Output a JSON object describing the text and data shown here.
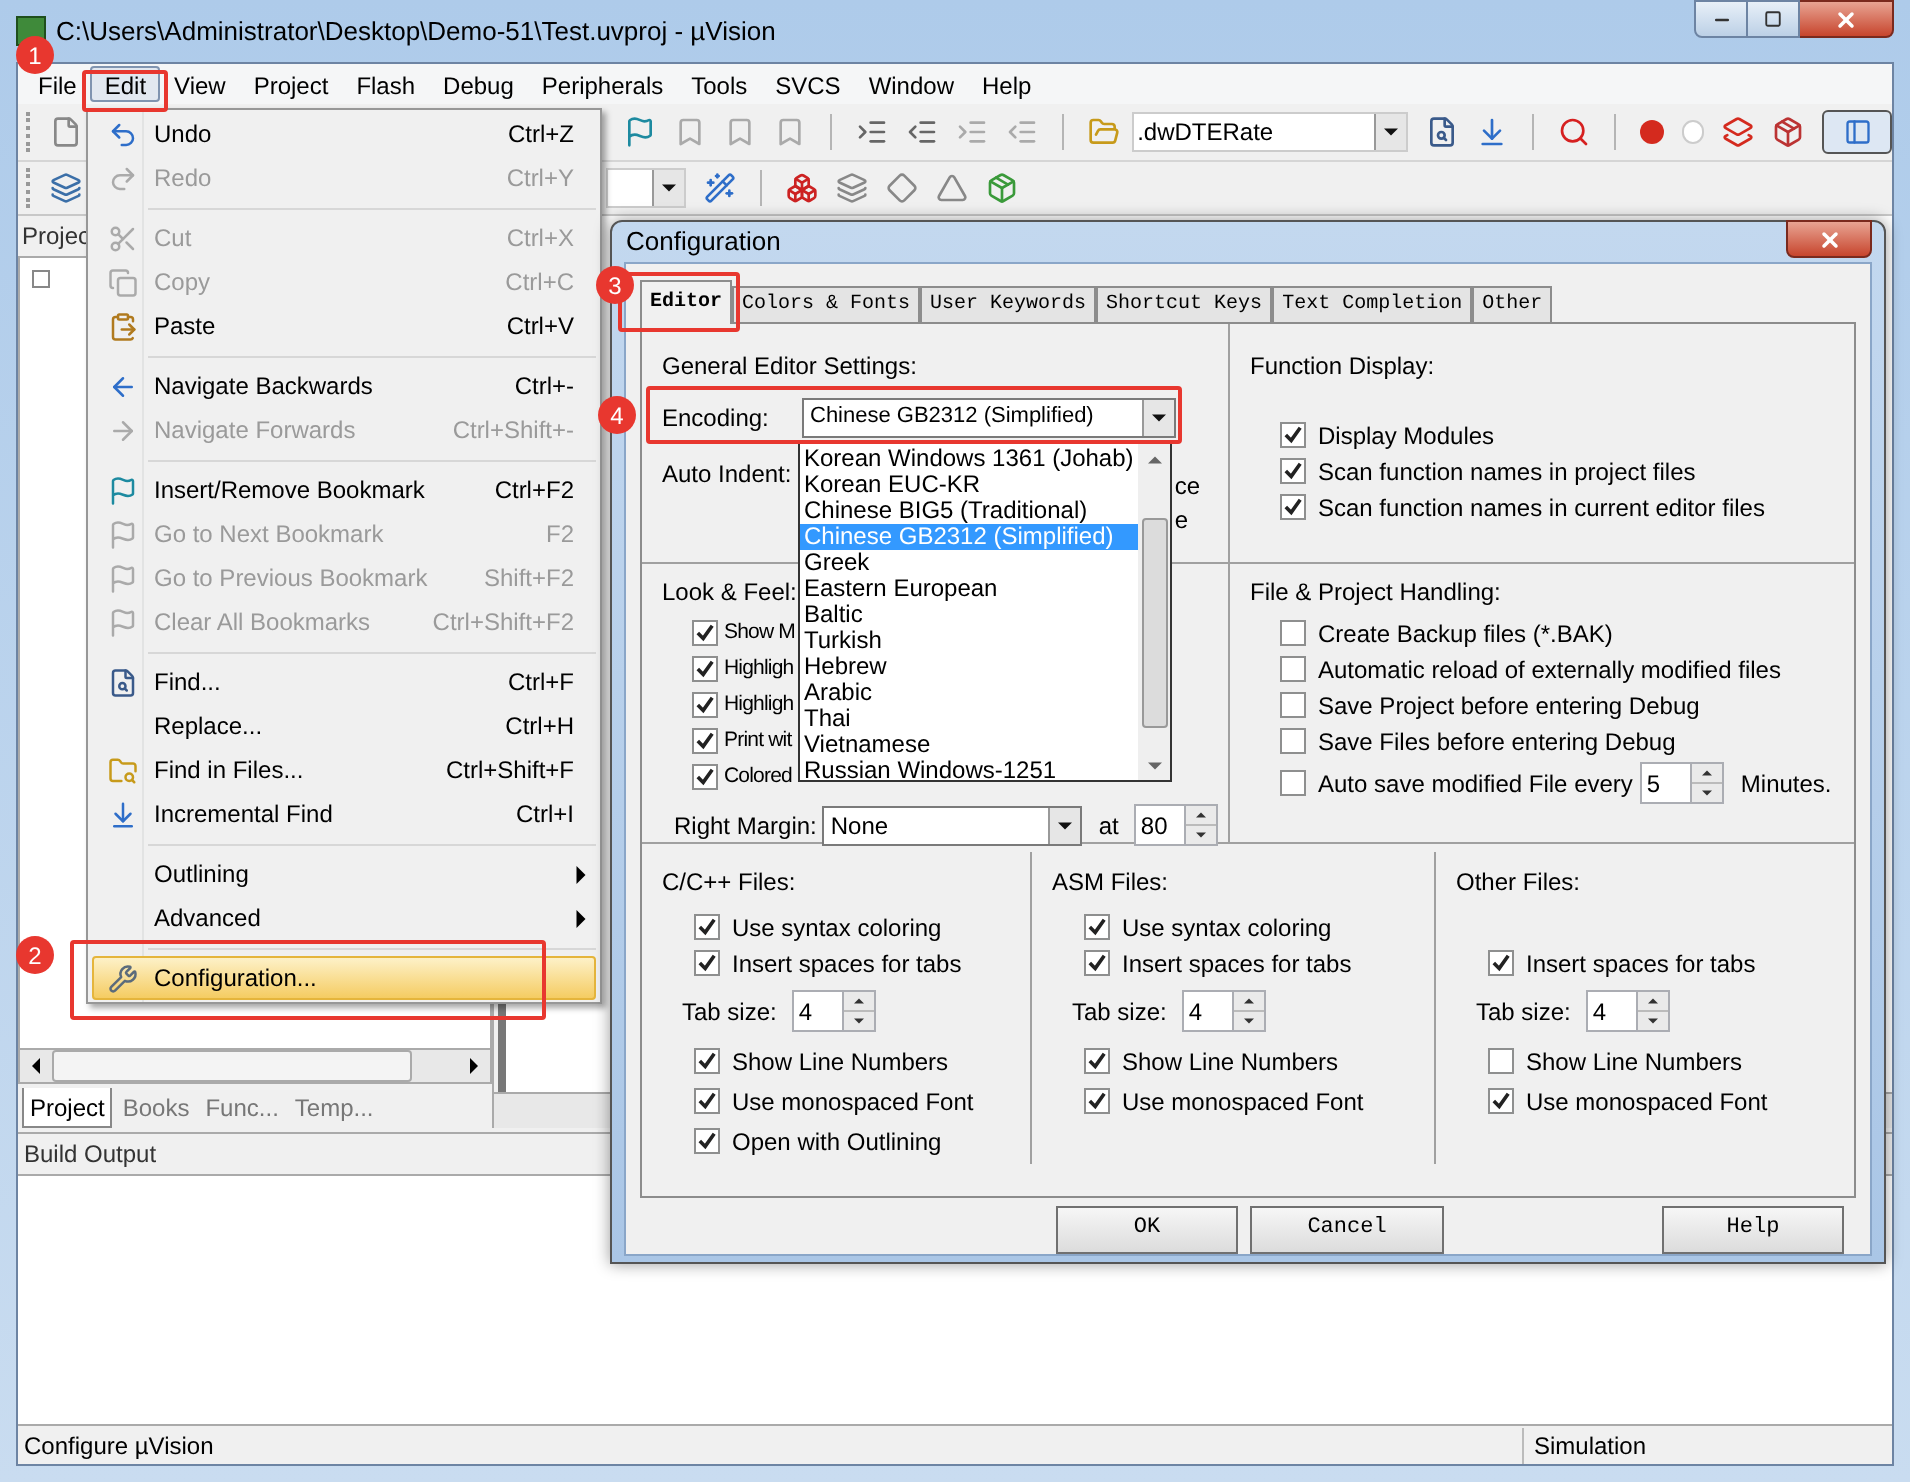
{
  "window": {
    "title": "C:\\Users\\Administrator\\Desktop\\Demo-51\\Test.uvproj - µVision"
  },
  "menu_bar": [
    {
      "label": "File",
      "selected": false
    },
    {
      "label": "Edit",
      "selected": true
    },
    {
      "label": "View",
      "selected": false
    },
    {
      "label": "Project",
      "selected": false
    },
    {
      "label": "Flash",
      "selected": false
    },
    {
      "label": "Debug",
      "selected": false
    },
    {
      "label": "Peripherals",
      "selected": false
    },
    {
      "label": "Tools",
      "selected": false
    },
    {
      "label": "SVCS",
      "selected": false
    },
    {
      "label": "Window",
      "selected": false
    },
    {
      "label": "Help",
      "selected": false
    }
  ],
  "toolbar": {
    "find_combo": ".dwDTERate"
  },
  "project_panel": {
    "title": "Projec",
    "tabs": [
      {
        "label": "Project",
        "selected": true
      },
      {
        "label": "Books",
        "selected": false
      },
      {
        "label": "Func...",
        "selected": false
      },
      {
        "label": "Temp...",
        "selected": false
      }
    ]
  },
  "build_output": {
    "title": "Build Output"
  },
  "status_bar": [
    "Configure µVision",
    "Simulation"
  ],
  "edit_menu": [
    {
      "kind": "item",
      "label": "Undo",
      "shortcut": "Ctrl+Z",
      "disabled": false,
      "selected": false
    },
    {
      "kind": "item",
      "label": "Redo",
      "shortcut": "Ctrl+Y",
      "disabled": true,
      "selected": false
    },
    {
      "kind": "separator"
    },
    {
      "kind": "item",
      "label": "Cut",
      "shortcut": "Ctrl+X",
      "disabled": true,
      "selected": false
    },
    {
      "kind": "item",
      "label": "Copy",
      "shortcut": "Ctrl+C",
      "disabled": true,
      "selected": false
    },
    {
      "kind": "item",
      "label": "Paste",
      "shortcut": "Ctrl+V",
      "disabled": false,
      "selected": false
    },
    {
      "kind": "separator"
    },
    {
      "kind": "item",
      "label": "Navigate Backwards",
      "shortcut": "Ctrl+-",
      "disabled": false,
      "selected": false
    },
    {
      "kind": "item",
      "label": "Navigate Forwards",
      "shortcut": "Ctrl+Shift+-",
      "disabled": true,
      "selected": false
    },
    {
      "kind": "separator"
    },
    {
      "kind": "item",
      "label": "Insert/Remove Bookmark",
      "shortcut": "Ctrl+F2",
      "disabled": false,
      "selected": false
    },
    {
      "kind": "item",
      "label": "Go to Next Bookmark",
      "shortcut": "F2",
      "disabled": true,
      "selected": false
    },
    {
      "kind": "item",
      "label": "Go to Previous Bookmark",
      "shortcut": "Shift+F2",
      "disabled": true,
      "selected": false
    },
    {
      "kind": "item",
      "label": "Clear All Bookmarks",
      "shortcut": "Ctrl+Shift+F2",
      "disabled": true,
      "selected": false
    },
    {
      "kind": "separator"
    },
    {
      "kind": "item",
      "label": "Find...",
      "shortcut": "Ctrl+F",
      "disabled": false,
      "selected": false
    },
    {
      "kind": "item",
      "label": "Replace...",
      "shortcut": "Ctrl+H",
      "disabled": false,
      "selected": false
    },
    {
      "kind": "item",
      "label": "Find in Files...",
      "shortcut": "Ctrl+Shift+F",
      "disabled": false,
      "selected": false
    },
    {
      "kind": "item",
      "label": "Incremental Find",
      "shortcut": "Ctrl+I",
      "disabled": false,
      "selected": false
    },
    {
      "kind": "separator"
    },
    {
      "kind": "submenu",
      "label": "Outlining",
      "disabled": false,
      "selected": false
    },
    {
      "kind": "submenu",
      "label": "Advanced",
      "disabled": false,
      "selected": false
    },
    {
      "kind": "separator"
    },
    {
      "kind": "item",
      "label": "Configuration...",
      "disabled": false,
      "selected": true
    }
  ],
  "dialog": {
    "title": "Configuration",
    "tabs": [
      {
        "label": "Editor",
        "selected": true
      },
      {
        "label": "Colors & Fonts",
        "selected": false
      },
      {
        "label": "User Keywords",
        "selected": false
      },
      {
        "label": "Shortcut Keys",
        "selected": false
      },
      {
        "label": "Text Completion",
        "selected": false
      },
      {
        "label": "Other",
        "selected": false
      }
    ],
    "general": {
      "title": "General Editor Settings:",
      "encoding_label": "Encoding:",
      "encoding_value": "Chinese GB2312 (Simplified)",
      "auto_indent_label": "Auto Indent:",
      "hidden_option_fragments": [
        "ce",
        "e"
      ]
    },
    "encoding_list": [
      {
        "label": "Korean Windows 1361 (Johab)",
        "selected": false
      },
      {
        "label": "Korean EUC-KR",
        "selected": false
      },
      {
        "label": "Chinese BIG5 (Traditional)",
        "selected": false
      },
      {
        "label": "Chinese GB2312 (Simplified)",
        "selected": true
      },
      {
        "label": "Greek",
        "selected": false
      },
      {
        "label": "Eastern European",
        "selected": false
      },
      {
        "label": "Baltic",
        "selected": false
      },
      {
        "label": "Turkish",
        "selected": false
      },
      {
        "label": "Hebrew",
        "selected": false
      },
      {
        "label": "Arabic",
        "selected": false
      },
      {
        "label": "Thai",
        "selected": false
      },
      {
        "label": "Vietnamese",
        "selected": false
      },
      {
        "label": "Russian Windows-1251",
        "selected": false
      }
    ],
    "function_display": {
      "title": "Function Display:",
      "options": [
        {
          "label": "Display Modules",
          "checked": true
        },
        {
          "label": "Scan function names in project files",
          "checked": true
        },
        {
          "label": "Scan function names in current editor files",
          "checked": true
        }
      ]
    },
    "look_and_feel": {
      "title": "Look & Feel:",
      "options": [
        {
          "label": "Show M",
          "checked": true
        },
        {
          "label": "Highligh",
          "checked": true
        },
        {
          "label": "Highligh",
          "checked": true
        },
        {
          "label": "Print wit",
          "checked": true
        },
        {
          "label": "Colored",
          "checked": true
        }
      ],
      "right_margin_label": "Right Margin:",
      "right_margin_value": "None",
      "at_label": "at",
      "at_value": "80"
    },
    "file_handling": {
      "title": "File & Project Handling:",
      "options": [
        {
          "label": "Create Backup files (*.BAK)",
          "checked": false
        },
        {
          "label": "Automatic reload of externally modified files",
          "checked": false
        },
        {
          "label": "Save Project before entering Debug",
          "checked": false
        },
        {
          "label": "Save Files before entering Debug",
          "checked": false
        },
        {
          "label": "Auto save modified File every",
          "checked": false
        }
      ],
      "minutes_value": "5",
      "minutes_label": "Minutes."
    },
    "file_types": [
      {
        "title": "C/C++ Files:",
        "options": [
          {
            "kind": "check",
            "label": "Use syntax coloring",
            "checked": true
          },
          {
            "kind": "check",
            "label": "Insert spaces for tabs",
            "checked": true
          },
          {
            "kind": "tab_size",
            "label": "Tab size:",
            "value": "4"
          },
          {
            "kind": "check",
            "label": "Show Line Numbers",
            "checked": true
          },
          {
            "kind": "check",
            "label": "Use monospaced Font",
            "checked": true
          },
          {
            "kind": "check",
            "label": "Open with Outlining",
            "checked": true
          }
        ]
      },
      {
        "title": "ASM Files:",
        "options": [
          {
            "kind": "check",
            "label": "Use syntax coloring",
            "checked": true
          },
          {
            "kind": "check",
            "label": "Insert spaces for tabs",
            "checked": true
          },
          {
            "kind": "tab_size",
            "label": "Tab size:",
            "value": "4"
          },
          {
            "kind": "check",
            "label": "Show Line Numbers",
            "checked": true
          },
          {
            "kind": "check",
            "label": "Use monospaced Font",
            "checked": true
          }
        ]
      },
      {
        "title": "Other Files:",
        "options": [
          {
            "kind": "blank"
          },
          {
            "kind": "check",
            "label": "Insert spaces for tabs",
            "checked": true
          },
          {
            "kind": "tab_size",
            "label": "Tab size:",
            "value": "4"
          },
          {
            "kind": "check",
            "label": "Show Line Numbers",
            "checked": false
          },
          {
            "kind": "check",
            "label": "Use monospaced Font",
            "checked": true
          }
        ]
      }
    ],
    "buttons": [
      "OK",
      "Cancel",
      "Help"
    ]
  },
  "annotations": [
    "1",
    "2",
    "3",
    "4"
  ]
}
